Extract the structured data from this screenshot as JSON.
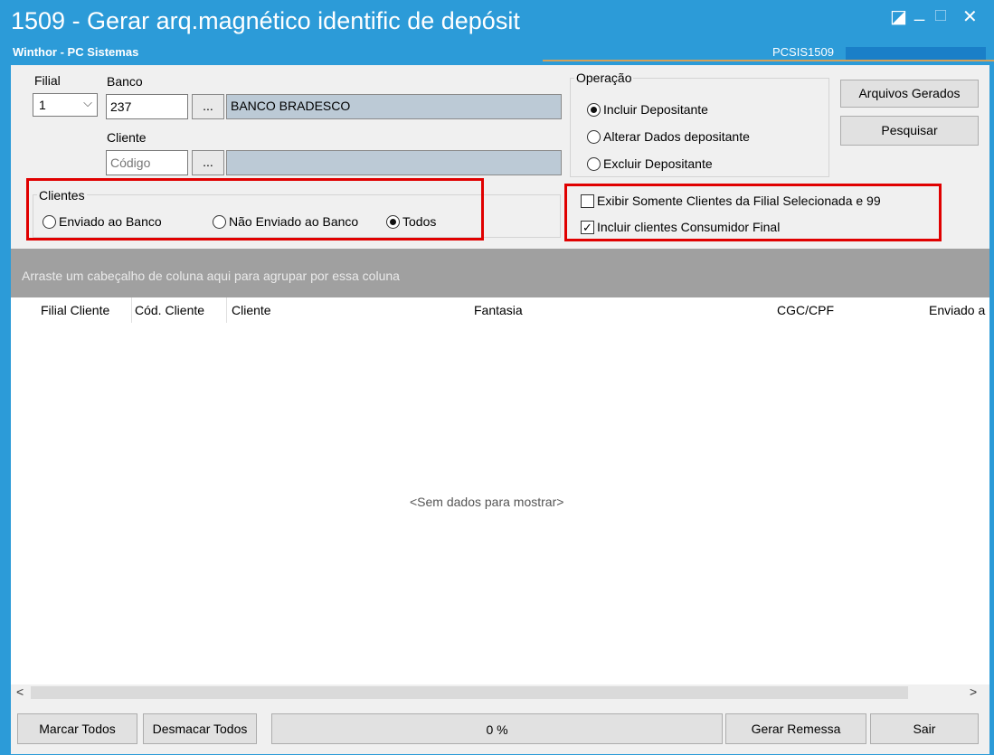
{
  "window": {
    "title": "1509 - Gerar arq.magnético identific de depósit",
    "subtitle": "Winthor - PC Sistemas",
    "form_code": "PCSIS1509",
    "controls": {
      "restore": "◪",
      "minimize": "_",
      "maximize": "□",
      "close": "✕"
    }
  },
  "filters": {
    "filial_label": "Filial",
    "filial_value": "1",
    "banco_label": "Banco",
    "banco_code": "237",
    "banco_name": "BANCO BRADESCO",
    "cliente_label": "Cliente",
    "cliente_placeholder": "Código",
    "lookup_button": "..."
  },
  "operacao": {
    "title": "Operação",
    "options": [
      {
        "label": "Incluir Depositante",
        "selected": true
      },
      {
        "label": "Alterar Dados depositante",
        "selected": false
      },
      {
        "label": "Excluir Depositante",
        "selected": false
      }
    ]
  },
  "actions": {
    "arquivos_gerados": "Arquivos Gerados",
    "pesquisar": "Pesquisar"
  },
  "clientes": {
    "title": "Clientes",
    "options": [
      {
        "label": "Enviado ao Banco",
        "selected": false
      },
      {
        "label": "Não Enviado ao Banco",
        "selected": false
      },
      {
        "label": "Todos",
        "selected": true
      }
    ]
  },
  "checkboxes": {
    "somente_filial": {
      "label": "Exibir Somente Clientes da Filial Selecionada e  99",
      "checked": false
    },
    "consumidor_final": {
      "label": "Incluir clientes Consumidor Final",
      "checked": true
    }
  },
  "grid": {
    "group_hint": "Arraste um cabeçalho de coluna aqui para agrupar por essa coluna",
    "columns": [
      "Filial Cliente",
      "Cód. Cliente",
      "Cliente",
      "Fantasia",
      "CGC/CPF",
      "Enviado a"
    ],
    "empty_message": "<Sem dados para mostrar>"
  },
  "footer": {
    "marcar_todos": "Marcar Todos",
    "desmarcar_todos": "Desmacar Todos",
    "progress": "0 %",
    "progress_value": 0,
    "gerar_remessa": "Gerar Remessa",
    "sair": "Sair"
  },
  "colors": {
    "title_bar": "#2c9bd8",
    "highlight_box": "#e00000",
    "group_panel": "#a0a0a0",
    "readonly_field": "#bccad6"
  }
}
